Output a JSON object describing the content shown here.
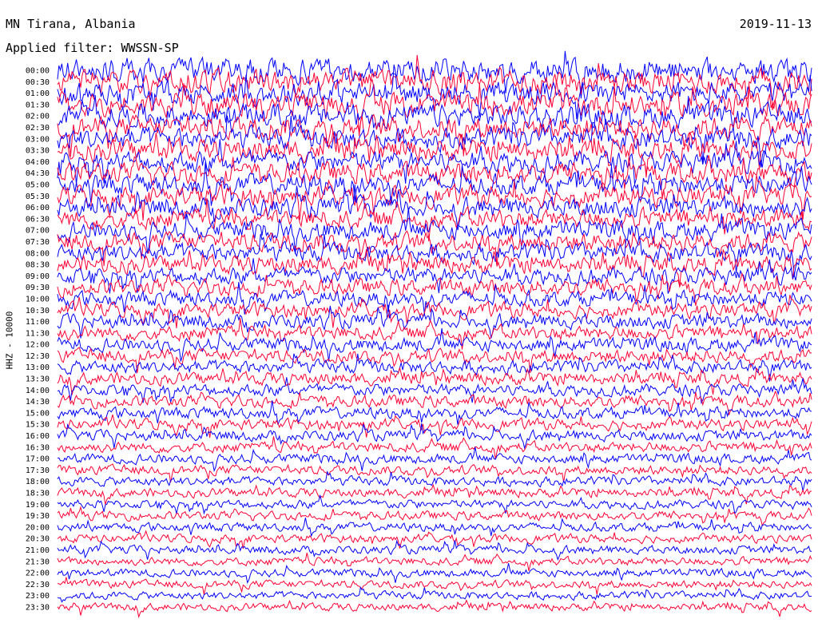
{
  "header": {
    "station": "MN Tirana, Albania",
    "date": "2019-11-13",
    "filter": "Applied filter: WWSSN-SP"
  },
  "chart_data": {
    "type": "line",
    "ylabel": "HHZ - 10000",
    "row_labels": [
      "00:00",
      "00:30",
      "01:00",
      "01:30",
      "02:00",
      "02:30",
      "03:00",
      "03:30",
      "04:00",
      "04:30",
      "05:00",
      "05:30",
      "06:00",
      "06:30",
      "07:00",
      "07:30",
      "08:00",
      "08:30",
      "09:00",
      "09:30",
      "10:00",
      "10:30",
      "11:00",
      "11:30",
      "12:00",
      "12:30",
      "13:00",
      "13:30",
      "14:00",
      "14:30",
      "15:00",
      "15:30",
      "16:00",
      "16:30",
      "17:00",
      "17:30",
      "18:00",
      "18:30",
      "19:00",
      "19:30",
      "20:00",
      "20:30",
      "21:00",
      "21:30",
      "22:00",
      "22:30",
      "23:00",
      "23:30"
    ],
    "trace_colors": [
      "#0000ff",
      "#ff0033"
    ],
    "noise_amplitude_by_hour": [
      [
        0,
        1.6
      ],
      [
        5,
        1.35
      ],
      [
        8,
        1.2
      ],
      [
        10,
        1.0
      ],
      [
        14,
        0.8
      ],
      [
        18,
        0.6
      ],
      [
        23.5,
        0.5
      ]
    ]
  }
}
